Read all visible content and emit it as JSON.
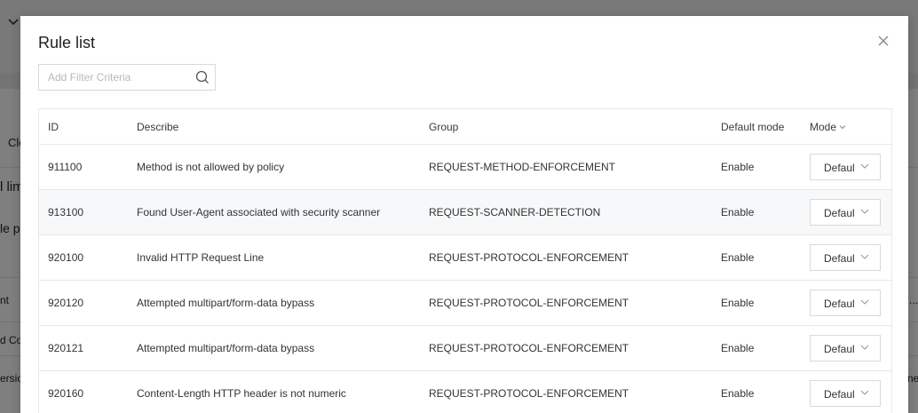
{
  "background": {
    "fragments": [
      "Clo",
      "l lim",
      "le pa",
      "nt",
      "d Co",
      "ersio",
      "...",
      "ne."
    ]
  },
  "modal": {
    "title": "Rule list",
    "search": {
      "placeholder": "Add Filter Criteria",
      "value": ""
    },
    "table": {
      "headers": {
        "id": "ID",
        "describe": "Describe",
        "group": "Group",
        "default_mode": "Default mode",
        "mode": "Mode"
      },
      "rows": [
        {
          "id": "911100",
          "describe": "Method is not allowed by policy",
          "group": "REQUEST-METHOD-ENFORCEMENT",
          "default_mode": "Enable",
          "mode": "Default"
        },
        {
          "id": "913100",
          "describe": "Found User-Agent associated with security scanner",
          "group": "REQUEST-SCANNER-DETECTION",
          "default_mode": "Enable",
          "mode": "Default"
        },
        {
          "id": "920100",
          "describe": "Invalid HTTP Request Line",
          "group": "REQUEST-PROTOCOL-ENFORCEMENT",
          "default_mode": "Enable",
          "mode": "Default"
        },
        {
          "id": "920120",
          "describe": "Attempted multipart/form-data bypass",
          "group": "REQUEST-PROTOCOL-ENFORCEMENT",
          "default_mode": "Enable",
          "mode": "Default"
        },
        {
          "id": "920121",
          "describe": "Attempted multipart/form-data bypass",
          "group": "REQUEST-PROTOCOL-ENFORCEMENT",
          "default_mode": "Enable",
          "mode": "Default"
        },
        {
          "id": "920160",
          "describe": "Content-Length HTTP header is not numeric",
          "group": "REQUEST-PROTOCOL-ENFORCEMENT",
          "default_mode": "Enable",
          "mode": "Default"
        }
      ]
    }
  },
  "icons": {
    "close": "close-icon",
    "search": "search-icon",
    "sort": "chevron-down-icon",
    "select": "chevron-down-icon"
  },
  "colors": {
    "overlay": "#7a7a7a",
    "alt_row": "#f7f8fa",
    "border": "#e8e8e8"
  }
}
